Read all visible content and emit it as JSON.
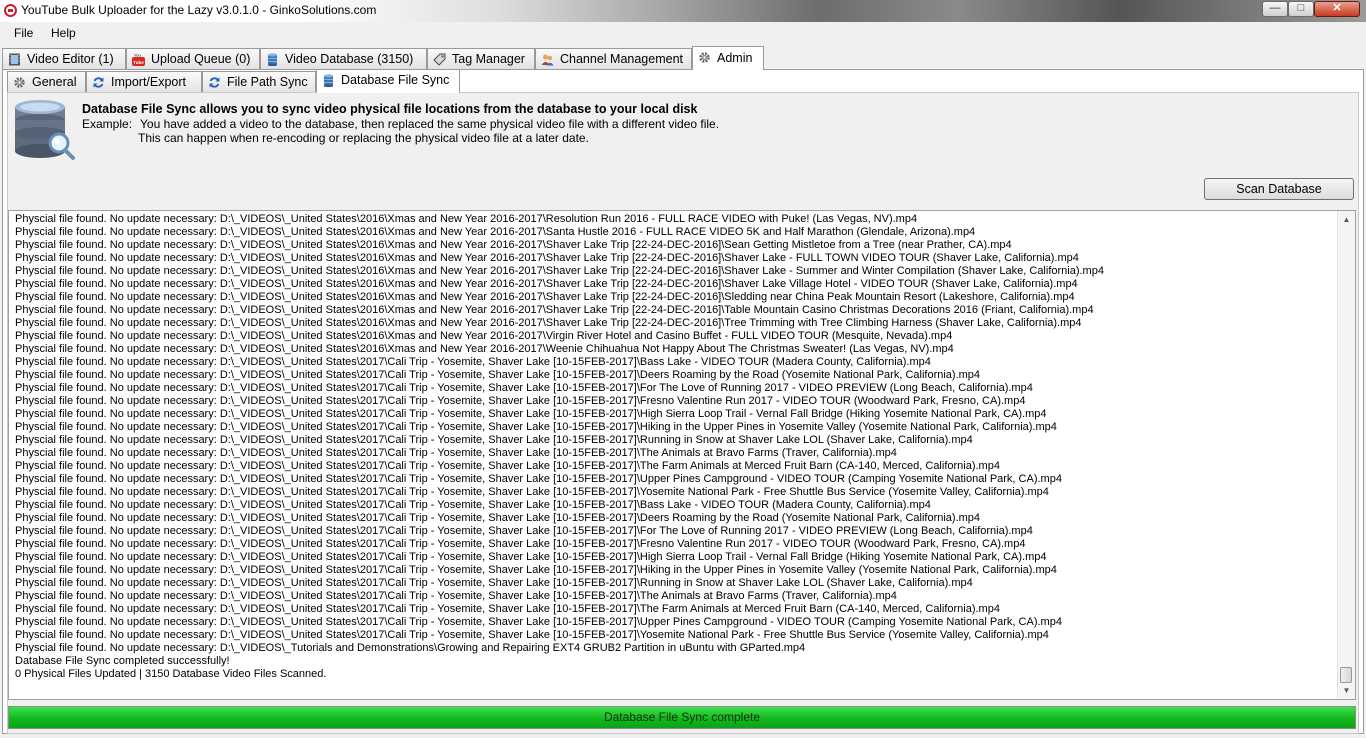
{
  "window": {
    "title": "YouTube Bulk Uploader for the Lazy v3.0.1.0 - GinkoSolutions.com"
  },
  "menu": {
    "file": "File",
    "help": "Help"
  },
  "main_tabs": [
    {
      "label": "Video Editor (1)",
      "icon": "film-icon"
    },
    {
      "label": "Upload Queue (0)",
      "icon": "youtube-icon"
    },
    {
      "label": "Video Database (3150)",
      "icon": "database-icon"
    },
    {
      "label": "Tag Manager",
      "icon": "tag-icon"
    },
    {
      "label": "Channel Management",
      "icon": "users-icon"
    },
    {
      "label": "Admin",
      "icon": "gear-icon"
    }
  ],
  "sub_tabs": [
    {
      "label": "General",
      "icon": "gear-icon"
    },
    {
      "label": "Import/Export",
      "icon": "refresh-icon"
    },
    {
      "label": "File Path Sync",
      "icon": "refresh-icon"
    },
    {
      "label": "Database File Sync",
      "icon": "database-icon"
    }
  ],
  "sync_page": {
    "heading": "Database File Sync allows you to sync video physical file locations from the database to your local disk",
    "example_label": "Example:",
    "example_line1": "You have added a video to the database, then replaced the same physical video file with a different video file.",
    "example_line2": "This can happen when re-encoding or replacing the physical video file at a later date.",
    "scan_button": "Scan Database"
  },
  "log": [
    "Physcial file found. No update necessary: D:\\_VIDEOS\\_United States\\2016\\Xmas and New Year 2016-2017\\Resolution Run 2016 - FULL RACE VIDEO with Puke! (Las Vegas, NV).mp4",
    "Physcial file found. No update necessary: D:\\_VIDEOS\\_United States\\2016\\Xmas and New Year 2016-2017\\Santa Hustle 2016 - FULL RACE VIDEO 5K and Half Marathon (Glendale, Arizona).mp4",
    "Physcial file found. No update necessary: D:\\_VIDEOS\\_United States\\2016\\Xmas and New Year 2016-2017\\Shaver Lake Trip [22-24-DEC-2016]\\Sean Getting Mistletoe from a Tree (near Prather, CA).mp4",
    "Physcial file found. No update necessary: D:\\_VIDEOS\\_United States\\2016\\Xmas and New Year 2016-2017\\Shaver Lake Trip [22-24-DEC-2016]\\Shaver Lake - FULL TOWN VIDEO TOUR (Shaver Lake, California).mp4",
    "Physcial file found. No update necessary: D:\\_VIDEOS\\_United States\\2016\\Xmas and New Year 2016-2017\\Shaver Lake Trip [22-24-DEC-2016]\\Shaver Lake - Summer and Winter Compilation (Shaver Lake, California).mp4",
    "Physcial file found. No update necessary: D:\\_VIDEOS\\_United States\\2016\\Xmas and New Year 2016-2017\\Shaver Lake Trip [22-24-DEC-2016]\\Shaver Lake Village Hotel - VIDEO TOUR (Shaver Lake, California).mp4",
    "Physcial file found. No update necessary: D:\\_VIDEOS\\_United States\\2016\\Xmas and New Year 2016-2017\\Shaver Lake Trip [22-24-DEC-2016]\\Sledding near China Peak Mountain Resort (Lakeshore, California).mp4",
    "Physcial file found. No update necessary: D:\\_VIDEOS\\_United States\\2016\\Xmas and New Year 2016-2017\\Shaver Lake Trip [22-24-DEC-2016]\\Table Mountain Casino Christmas Decorations 2016 (Friant, California).mp4",
    "Physcial file found. No update necessary: D:\\_VIDEOS\\_United States\\2016\\Xmas and New Year 2016-2017\\Shaver Lake Trip [22-24-DEC-2016]\\Tree Trimming with Tree Climbing Harness (Shaver Lake, California).mp4",
    "Physcial file found. No update necessary: D:\\_VIDEOS\\_United States\\2016\\Xmas and New Year 2016-2017\\Virgin River Hotel and Casino Buffet - FULL VIDEO TOUR (Mesquite, Nevada).mp4",
    "Physcial file found. No update necessary: D:\\_VIDEOS\\_United States\\2016\\Xmas and New Year 2016-2017\\Weenie Chihuahua Not Happy About The Christmas Sweater! (Las Vegas, NV).mp4",
    "Physcial file found. No update necessary: D:\\_VIDEOS\\_United States\\2017\\Cali Trip - Yosemite, Shaver Lake [10-15FEB-2017]\\Bass Lake - VIDEO TOUR (Madera County, California).mp4",
    "Physcial file found. No update necessary: D:\\_VIDEOS\\_United States\\2017\\Cali Trip - Yosemite, Shaver Lake [10-15FEB-2017]\\Deers Roaming by the Road (Yosemite National Park, California).mp4",
    "Physcial file found. No update necessary: D:\\_VIDEOS\\_United States\\2017\\Cali Trip - Yosemite, Shaver Lake [10-15FEB-2017]\\For The Love of Running 2017 - VIDEO PREVIEW (Long Beach, California).mp4",
    "Physcial file found. No update necessary: D:\\_VIDEOS\\_United States\\2017\\Cali Trip - Yosemite, Shaver Lake [10-15FEB-2017]\\Fresno Valentine Run 2017 - VIDEO TOUR (Woodward Park, Fresno, CA).mp4",
    "Physcial file found. No update necessary: D:\\_VIDEOS\\_United States\\2017\\Cali Trip - Yosemite, Shaver Lake [10-15FEB-2017]\\High Sierra Loop Trail - Vernal Fall Bridge (Hiking Yosemite National Park, CA).mp4",
    "Physcial file found. No update necessary: D:\\_VIDEOS\\_United States\\2017\\Cali Trip - Yosemite, Shaver Lake [10-15FEB-2017]\\Hiking in the Upper Pines in Yosemite Valley (Yosemite National Park, California).mp4",
    "Physcial file found. No update necessary: D:\\_VIDEOS\\_United States\\2017\\Cali Trip - Yosemite, Shaver Lake [10-15FEB-2017]\\Running in Snow at Shaver Lake LOL (Shaver Lake, California).mp4",
    "Physcial file found. No update necessary: D:\\_VIDEOS\\_United States\\2017\\Cali Trip - Yosemite, Shaver Lake [10-15FEB-2017]\\The Animals at Bravo Farms (Traver, California).mp4",
    "Physcial file found. No update necessary: D:\\_VIDEOS\\_United States\\2017\\Cali Trip - Yosemite, Shaver Lake [10-15FEB-2017]\\The Farm Animals at Merced Fruit Barn (CA-140, Merced, California).mp4",
    "Physcial file found. No update necessary: D:\\_VIDEOS\\_United States\\2017\\Cali Trip - Yosemite, Shaver Lake [10-15FEB-2017]\\Upper Pines Campground - VIDEO TOUR (Camping Yosemite National Park, CA).mp4",
    "Physcial file found. No update necessary: D:\\_VIDEOS\\_United States\\2017\\Cali Trip - Yosemite, Shaver Lake [10-15FEB-2017]\\Yosemite National Park - Free Shuttle Bus Service (Yosemite Valley, California).mp4",
    "Physcial file found. No update necessary: D:\\_VIDEOS\\_United States\\2017\\Cali Trip - Yosemite, Shaver Lake [10-15FEB-2017]\\Bass Lake - VIDEO TOUR (Madera County, California).mp4",
    "Physcial file found. No update necessary: D:\\_VIDEOS\\_United States\\2017\\Cali Trip - Yosemite, Shaver Lake [10-15FEB-2017]\\Deers Roaming by the Road (Yosemite National Park, California).mp4",
    "Physcial file found. No update necessary: D:\\_VIDEOS\\_United States\\2017\\Cali Trip - Yosemite, Shaver Lake [10-15FEB-2017]\\For The Love of Running 2017 - VIDEO PREVIEW (Long Beach, California).mp4",
    "Physcial file found. No update necessary: D:\\_VIDEOS\\_United States\\2017\\Cali Trip - Yosemite, Shaver Lake [10-15FEB-2017]\\Fresno Valentine Run 2017 - VIDEO TOUR (Woodward Park, Fresno, CA).mp4",
    "Physcial file found. No update necessary: D:\\_VIDEOS\\_United States\\2017\\Cali Trip - Yosemite, Shaver Lake [10-15FEB-2017]\\High Sierra Loop Trail - Vernal Fall Bridge (Hiking Yosemite National Park, CA).mp4",
    "Physcial file found. No update necessary: D:\\_VIDEOS\\_United States\\2017\\Cali Trip - Yosemite, Shaver Lake [10-15FEB-2017]\\Hiking in the Upper Pines in Yosemite Valley (Yosemite National Park, California).mp4",
    "Physcial file found. No update necessary: D:\\_VIDEOS\\_United States\\2017\\Cali Trip - Yosemite, Shaver Lake [10-15FEB-2017]\\Running in Snow at Shaver Lake LOL (Shaver Lake, California).mp4",
    "Physcial file found. No update necessary: D:\\_VIDEOS\\_United States\\2017\\Cali Trip - Yosemite, Shaver Lake [10-15FEB-2017]\\The Animals at Bravo Farms (Traver, California).mp4",
    "Physcial file found. No update necessary: D:\\_VIDEOS\\_United States\\2017\\Cali Trip - Yosemite, Shaver Lake [10-15FEB-2017]\\The Farm Animals at Merced Fruit Barn (CA-140, Merced, California).mp4",
    "Physcial file found. No update necessary: D:\\_VIDEOS\\_United States\\2017\\Cali Trip - Yosemite, Shaver Lake [10-15FEB-2017]\\Upper Pines Campground - VIDEO TOUR (Camping Yosemite National Park, CA).mp4",
    "Physcial file found. No update necessary: D:\\_VIDEOS\\_United States\\2017\\Cali Trip - Yosemite, Shaver Lake [10-15FEB-2017]\\Yosemite National Park - Free Shuttle Bus Service (Yosemite Valley, California).mp4",
    "Physcial file found. No update necessary: D:\\_VIDEOS\\_Tutorials and Demonstrations\\Growing and Repairing EXT4 GRUB2 Partition in uBuntu with GParted.mp4",
    "Database File Sync completed successfully!",
    "0 Physical Files Updated | 3150 Database Video Files Scanned."
  ],
  "status": {
    "text": "Database File Sync complete",
    "progress": 1.0,
    "color": "#13b81f"
  }
}
